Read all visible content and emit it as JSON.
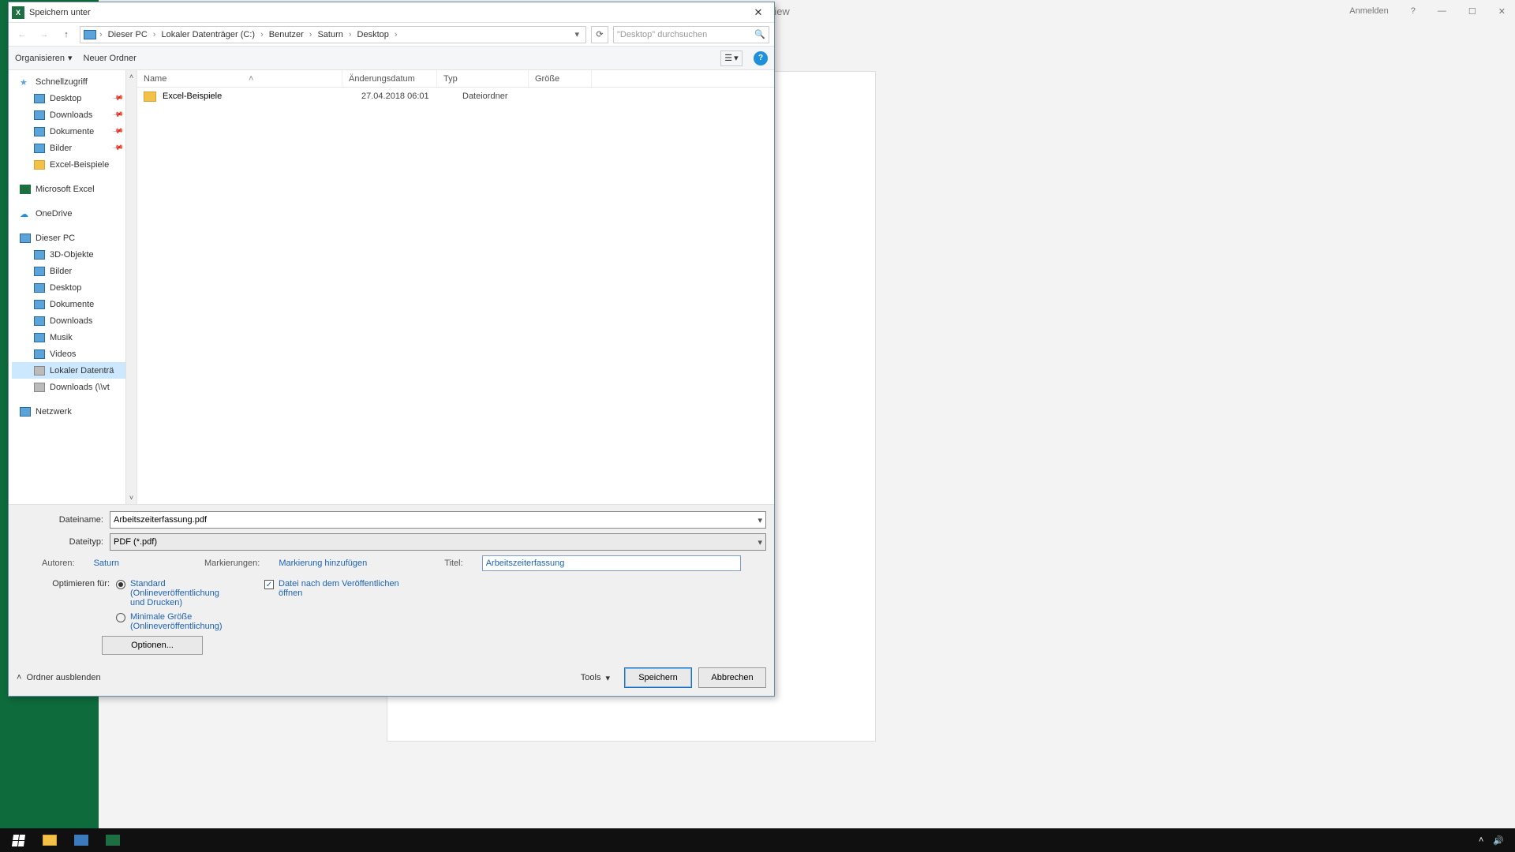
{
  "excel": {
    "title": "Excel Preview",
    "signin": "Anmelden",
    "help": "?",
    "min": "—",
    "max": "☐",
    "close": "✕"
  },
  "dialog": {
    "title": "Speichern unter",
    "close": "✕",
    "nav": {
      "back": "←",
      "fwd": "→",
      "up": "↑",
      "dd": "▾",
      "refresh": "⟳"
    },
    "crumbs": [
      "Dieser PC",
      "Lokaler Datenträger (C:)",
      "Benutzer",
      "Saturn",
      "Desktop"
    ],
    "crumbsep": "›",
    "search_placeholder": "\"Desktop\" durchsuchen",
    "toolbar": {
      "organize": "Organisieren",
      "orgdd": "▾",
      "newfolder": "Neuer Ordner",
      "viewdd": "▾",
      "help": "?"
    },
    "tree": {
      "quick": "Schnellzugriff",
      "quick_items": [
        "Desktop",
        "Downloads",
        "Dokumente",
        "Bilder",
        "Excel-Beispiele"
      ],
      "excel": "Microsoft Excel",
      "onedrive": "OneDrive",
      "pc": "Dieser PC",
      "pc_items": [
        "3D-Objekte",
        "Bilder",
        "Desktop",
        "Dokumente",
        "Downloads",
        "Musik",
        "Videos",
        "Lokaler Datenträ",
        "Downloads (\\\\vt"
      ],
      "network": "Netzwerk",
      "up": "˄",
      "down": "˅"
    },
    "cols": {
      "name": "Name",
      "date": "Änderungsdatum",
      "type": "Typ",
      "size": "Größe",
      "sortup": "˄"
    },
    "rows": [
      {
        "name": "Excel-Beispiele",
        "date": "27.04.2018 06:01",
        "type": "Dateiordner"
      }
    ],
    "fields": {
      "filename_lbl": "Dateiname:",
      "filename_val": "Arbeitszeiterfassung.pdf",
      "filetype_lbl": "Dateityp:",
      "filetype_val": "PDF (*.pdf)",
      "authors_lbl": "Autoren:",
      "authors_val": "Saturn",
      "tags_lbl": "Markierungen:",
      "tags_val": "Markierung hinzufügen",
      "title_lbl": "Titel:",
      "title_val": "Arbeitszeiterfassung",
      "optimize_lbl": "Optimieren für:",
      "opt_standard": "Standard (Onlineveröffentlichung und Drucken)",
      "opt_minimal": "Minimale Größe (Onlineveröffentlichung)",
      "open_after": "Datei nach dem Veröffentlichen öffnen",
      "options_btn": "Optionen...",
      "chk": "✓"
    },
    "actions": {
      "hide": "Ordner ausblenden",
      "hideico": "˄",
      "tools": "Tools",
      "toolsdd": "▾",
      "save": "Speichern",
      "cancel": "Abbrechen"
    }
  },
  "taskbar": {
    "up": "˄",
    "vol": "🔊"
  }
}
